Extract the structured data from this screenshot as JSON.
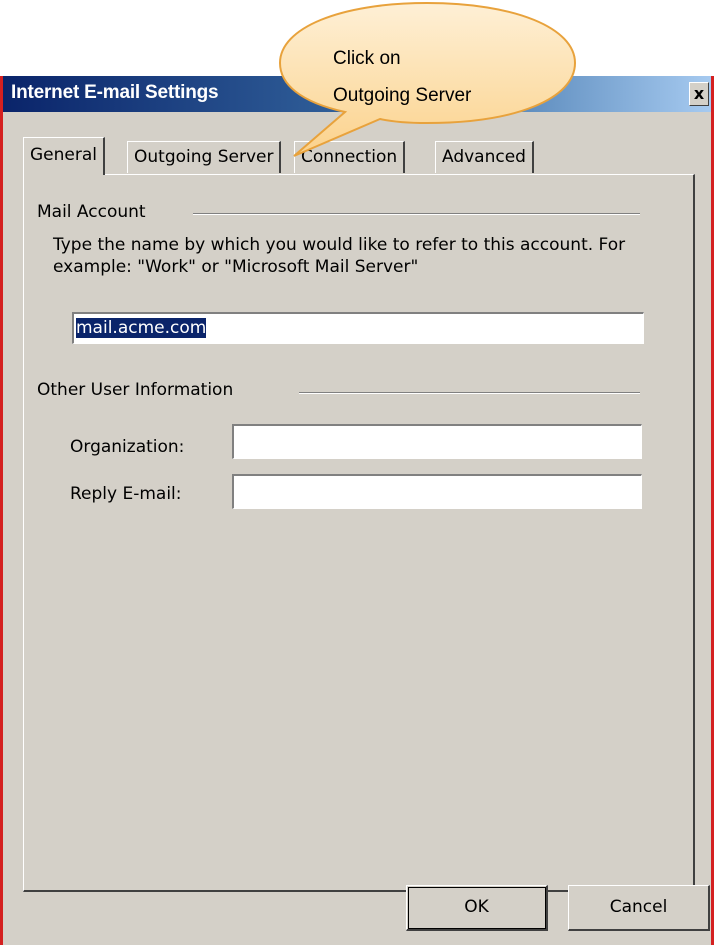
{
  "window": {
    "title": "Internet E-mail Settings",
    "close_glyph": "x"
  },
  "tabs": [
    {
      "label": "General",
      "active": true
    },
    {
      "label": "Outgoing Server",
      "active": false
    },
    {
      "label": "Connection",
      "active": false
    },
    {
      "label": "Advanced",
      "active": false
    }
  ],
  "mail_account": {
    "group_label": "Mail Account",
    "description": "Type the name by which you would like to refer to this account.  For example: \"Work\" or \"Microsoft Mail Server\"",
    "account_name_value": "mail.acme.com"
  },
  "other_user_info": {
    "group_label": "Other User Information",
    "organization_label": "Organization:",
    "organization_value": "",
    "reply_email_label": "Reply E-mail:",
    "reply_email_value": ""
  },
  "buttons": {
    "ok_label": "OK",
    "cancel_label": "Cancel"
  },
  "callout": {
    "line1": "Click on",
    "line2": "Outgoing Server"
  },
  "colors": {
    "title_bar": "#0a246a",
    "dialog_face": "#d4d0c8",
    "callout_fill": "#fde3b4",
    "callout_stroke": "#e8a23c",
    "border_accent": "#d42020"
  }
}
